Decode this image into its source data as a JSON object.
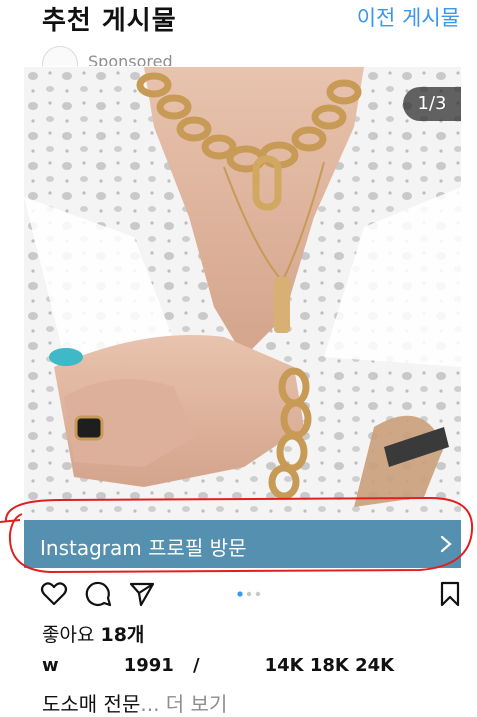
{
  "header": {
    "title": "추천 게시물",
    "prev_link": "이전 게시물"
  },
  "post": {
    "sponsored_label": "Sponsored",
    "media_counter": "1/3",
    "cta_label": "Instagram 프로필 방문",
    "carousel_position": {
      "current": 1,
      "total": 3
    },
    "likes_prefix": "좋아요 ",
    "likes_count": "18개",
    "caption_line1_start": "w",
    "caption_line1_mid": "1991",
    "caption_line1_end": "14K 18K 24K",
    "caption_line2": "도소매 전문",
    "more_label": "... 더 보기"
  },
  "icons": {
    "like": "heart-icon",
    "comment": "comment-icon",
    "share": "paper-plane-icon",
    "save": "bookmark-icon",
    "cta": "chevron-right-icon"
  },
  "colors": {
    "link": "#3897f0",
    "cta_bar": "#5590b0",
    "annotation": "#e02020"
  }
}
